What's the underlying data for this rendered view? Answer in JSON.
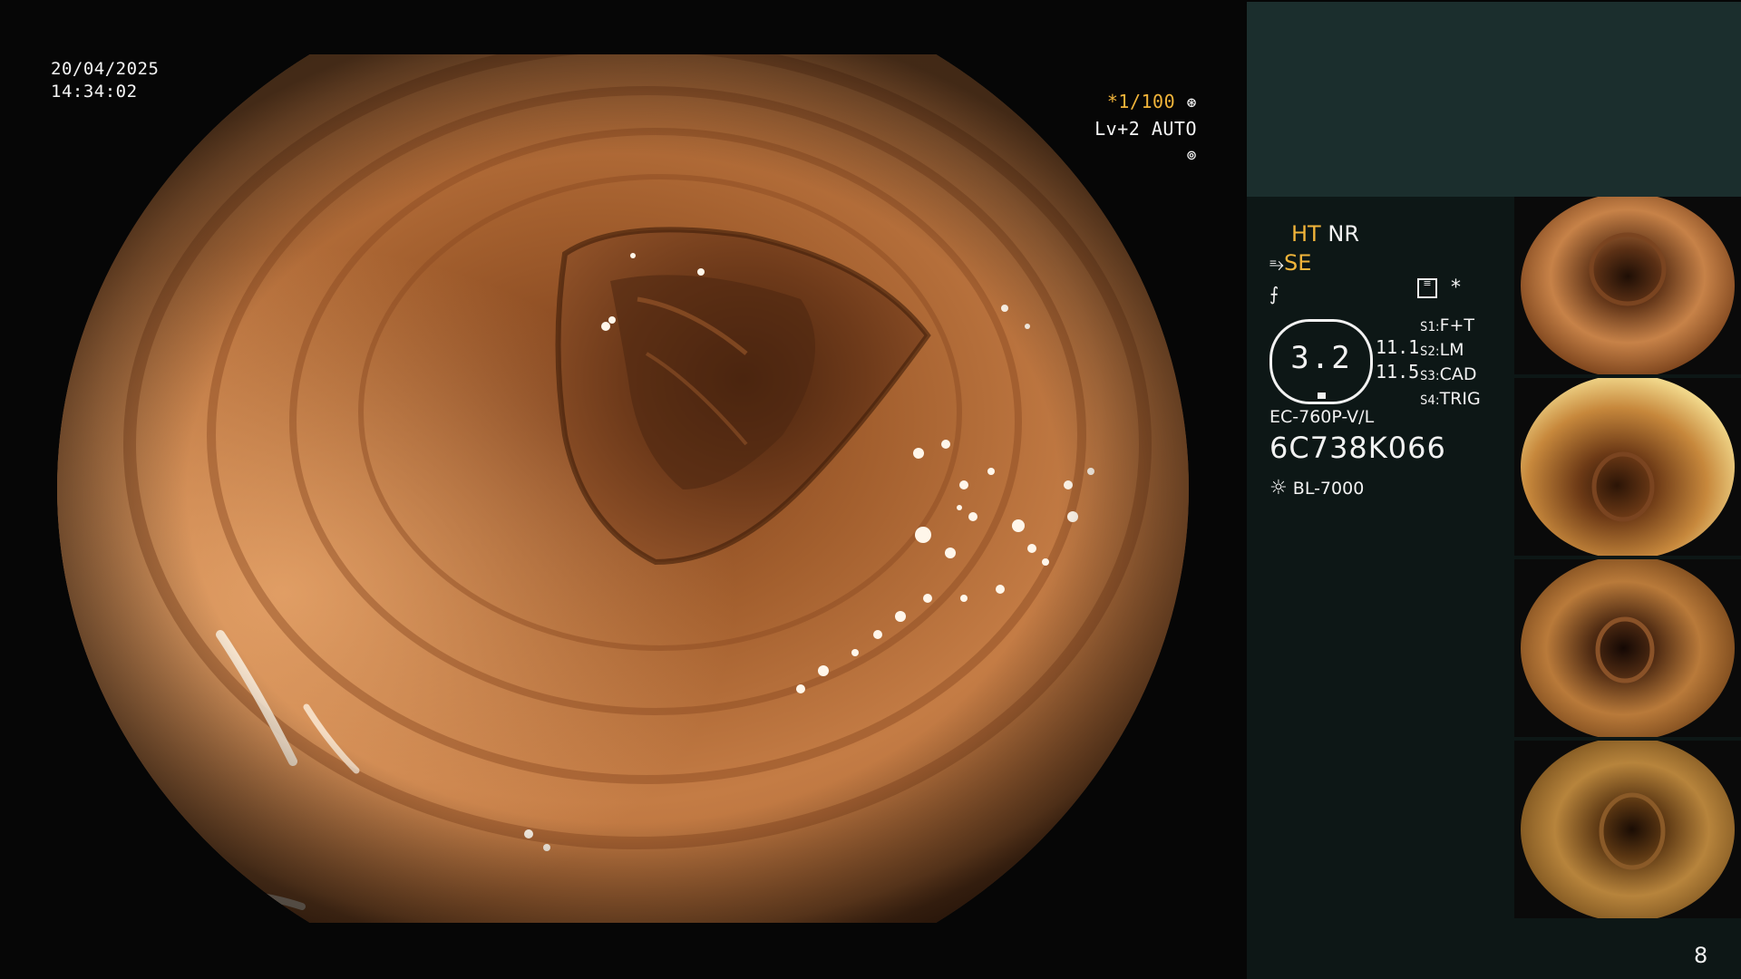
{
  "timestamp": {
    "date": "20/04/2025",
    "time": "14:34:02"
  },
  "view_overlay": {
    "shutter": "*1/100",
    "shutter_icon": "aperture-icon",
    "level": "Lv+2 AUTO",
    "level_icon": "iris-icon"
  },
  "settings": {
    "ht": "HT",
    "nr": "NR",
    "se": "SE",
    "structure_icon": "structure-enhance-icon",
    "tone_icon": "tone-icon",
    "menu_icon": "menu-settings-icon",
    "star": "*"
  },
  "zoom_badge": {
    "value": "3.2",
    "side_values": [
      "11.1",
      "11.5"
    ]
  },
  "switches": [
    {
      "key": "S1",
      "value": "F+T"
    },
    {
      "key": "S2",
      "value": "LM"
    },
    {
      "key": "S3",
      "value": "CAD"
    },
    {
      "key": "S4",
      "value": "TRIG"
    }
  ],
  "scope": {
    "model": "EC-760P-V/L",
    "serial": "6C738K066",
    "light_source": "BL-7000",
    "light_icon": "light-source-icon"
  },
  "thumbnails": [
    {
      "label": "captured-image-1"
    },
    {
      "label": "captured-image-2"
    },
    {
      "label": "captured-image-3"
    },
    {
      "label": "captured-image-4"
    }
  ],
  "page_number": "8",
  "colors": {
    "mucosa": "#b8713a",
    "lumen": "#3a1d0c",
    "panel_top": "#1b2e2d",
    "panel_lower": "#0d1716",
    "highlight": "#f1b43a"
  }
}
